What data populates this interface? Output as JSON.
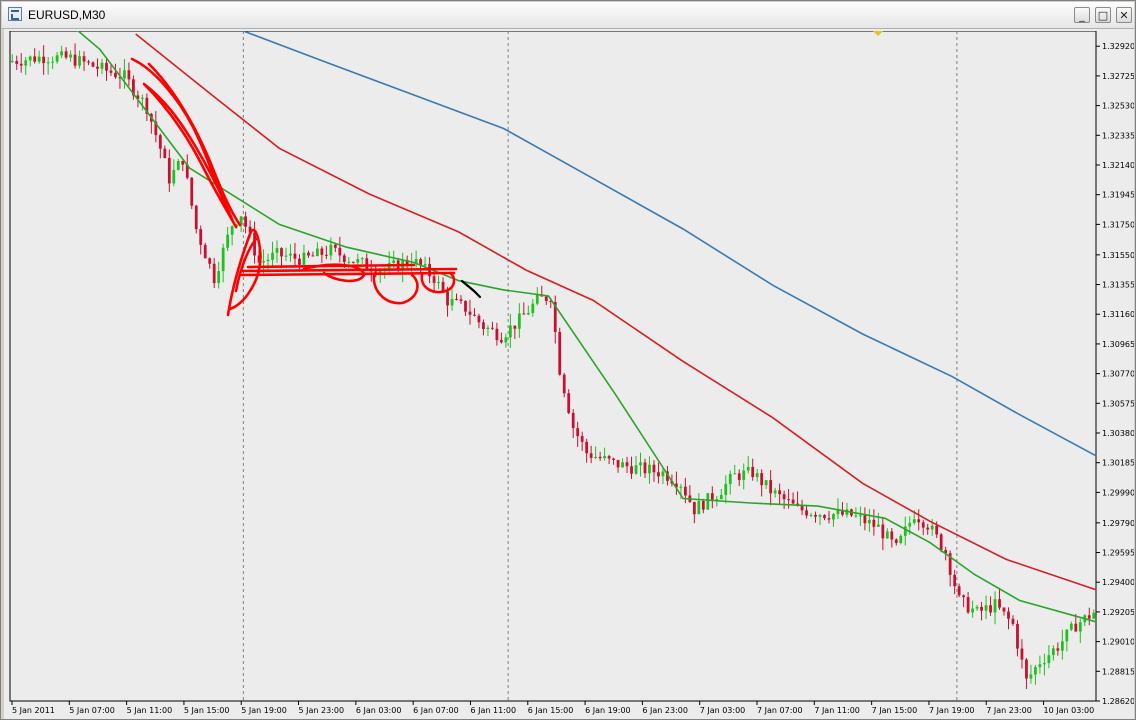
{
  "window": {
    "title": "EURUSD,M30",
    "buttons": {
      "minimize": "_",
      "maximize": "□",
      "close": "✕"
    }
  },
  "chart_data": {
    "type": "candlestick",
    "symbol": "EURUSD",
    "timeframe": "M30",
    "y_ticks": [
      "1.32920",
      "1.32725",
      "1.32530",
      "1.32335",
      "1.32140",
      "1.31945",
      "1.31750",
      "1.31550",
      "1.31355",
      "1.31160",
      "1.30965",
      "1.30770",
      "1.30575",
      "1.30380",
      "1.30185",
      "1.29990",
      "1.29790",
      "1.29595",
      "1.29400",
      "1.29205",
      "1.29010",
      "1.28815",
      "1.28620"
    ],
    "ylim": [
      1.2862,
      1.3302
    ],
    "x_ticks": [
      "5 Jan 2011",
      "5 Jan 07:00",
      "5 Jan 11:00",
      "5 Jan 15:00",
      "5 Jan 19:00",
      "5 Jan 23:00",
      "6 Jan 03:00",
      "6 Jan 07:00",
      "6 Jan 11:00",
      "6 Jan 15:00",
      "6 Jan 19:00",
      "6 Jan 23:00",
      "7 Jan 03:00",
      "7 Jan 07:00",
      "7 Jan 11:00",
      "7 Jan 15:00",
      "7 Jan 19:00",
      "7 Jan 23:00",
      "10 Jan 03:00"
    ],
    "period_separators": [
      "5 Jan 23:00",
      "6 Jan 23:00",
      "7 Jan 23:00"
    ],
    "close_path": [
      [
        0,
        1.3282
      ],
      [
        8,
        1.3285
      ],
      [
        14,
        1.3284
      ],
      [
        20,
        1.3278
      ],
      [
        26,
        1.3272
      ],
      [
        31,
        1.3252
      ],
      [
        34,
        1.3225
      ],
      [
        36,
        1.3205
      ],
      [
        39,
        1.3218
      ],
      [
        42,
        1.3172
      ],
      [
        46,
        1.314
      ],
      [
        50,
        1.3175
      ],
      [
        52,
        1.3182
      ],
      [
        56,
        1.315
      ],
      [
        60,
        1.3155
      ],
      [
        66,
        1.3152
      ],
      [
        72,
        1.3158
      ],
      [
        78,
        1.315
      ],
      [
        84,
        1.3145
      ],
      [
        90,
        1.3152
      ],
      [
        95,
        1.314
      ],
      [
        98,
        1.3125
      ],
      [
        102,
        1.312
      ],
      [
        106,
        1.3108
      ],
      [
        110,
        1.3102
      ],
      [
        114,
        1.3112
      ],
      [
        118,
        1.3125
      ],
      [
        121,
        1.3128
      ],
      [
        123,
        1.308
      ],
      [
        126,
        1.3042
      ],
      [
        129,
        1.3025
      ],
      [
        135,
        1.3018
      ],
      [
        140,
        1.3015
      ],
      [
        146,
        1.3012
      ],
      [
        150,
        1.3005
      ],
      [
        153,
        1.2988
      ],
      [
        158,
        1.2998
      ],
      [
        162,
        1.301
      ],
      [
        166,
        1.3012
      ],
      [
        170,
        1.3
      ],
      [
        176,
        1.2988
      ],
      [
        182,
        1.2985
      ],
      [
        188,
        1.2984
      ],
      [
        194,
        1.2976
      ],
      [
        198,
        1.2962
      ],
      [
        202,
        1.2985
      ],
      [
        205,
        1.2978
      ],
      [
        209,
        1.296
      ],
      [
        212,
        1.2928
      ],
      [
        216,
        1.292
      ],
      [
        220,
        1.2925
      ],
      [
        224,
        1.2912
      ],
      [
        227,
        1.2875
      ],
      [
        230,
        1.2888
      ],
      [
        234,
        1.2898
      ],
      [
        238,
        1.2912
      ],
      [
        242,
        1.292
      ]
    ],
    "candle_count": 242,
    "series": [
      {
        "kind": "moving-average",
        "color": "#2aa52a",
        "values": [
          [
            0,
            1.334
          ],
          [
            20,
            1.329
          ],
          [
            40,
            1.3212
          ],
          [
            60,
            1.3175
          ],
          [
            75,
            1.316
          ],
          [
            90,
            1.315
          ],
          [
            100,
            1.3138
          ],
          [
            110,
            1.3132
          ],
          [
            120,
            1.3128
          ],
          [
            135,
            1.3063
          ],
          [
            150,
            1.2995
          ],
          [
            165,
            1.2992
          ],
          [
            180,
            1.299
          ],
          [
            195,
            1.2982
          ],
          [
            205,
            1.2966
          ],
          [
            215,
            1.2945
          ],
          [
            225,
            1.2928
          ],
          [
            242,
            1.2914
          ]
        ]
      },
      {
        "kind": "moving-average",
        "color": "#d42020",
        "values": [
          [
            28,
            1.33
          ],
          [
            45,
            1.326
          ],
          [
            60,
            1.3225
          ],
          [
            80,
            1.3195
          ],
          [
            100,
            1.317
          ],
          [
            115,
            1.3145
          ],
          [
            130,
            1.3125
          ],
          [
            150,
            1.3085
          ],
          [
            170,
            1.3048
          ],
          [
            190,
            1.3005
          ],
          [
            205,
            1.298
          ],
          [
            222,
            1.2955
          ],
          [
            242,
            1.2935
          ]
        ]
      },
      {
        "kind": "moving-average",
        "color": "#3a7ab0",
        "values": [
          [
            52,
            1.3302
          ],
          [
            70,
            1.3282
          ],
          [
            90,
            1.326
          ],
          [
            110,
            1.3238
          ],
          [
            130,
            1.3205
          ],
          [
            150,
            1.3172
          ],
          [
            170,
            1.3135
          ],
          [
            190,
            1.3103
          ],
          [
            210,
            1.3075
          ],
          [
            225,
            1.305
          ],
          [
            242,
            1.3023
          ]
        ]
      }
    ],
    "annotations": [
      {
        "kind": "freehand",
        "color": "#ff0000",
        "description": "hand-drawn red marks"
      },
      {
        "kind": "freehand",
        "color": "#000000",
        "description": "small black mark"
      },
      {
        "kind": "marker",
        "color": "#e8c020",
        "shape": "triangle-down"
      }
    ],
    "colors": {
      "bull": "#1fc11f",
      "bear": "#c8102e",
      "background": "#ececec",
      "grid_separator": "#808080"
    }
  }
}
